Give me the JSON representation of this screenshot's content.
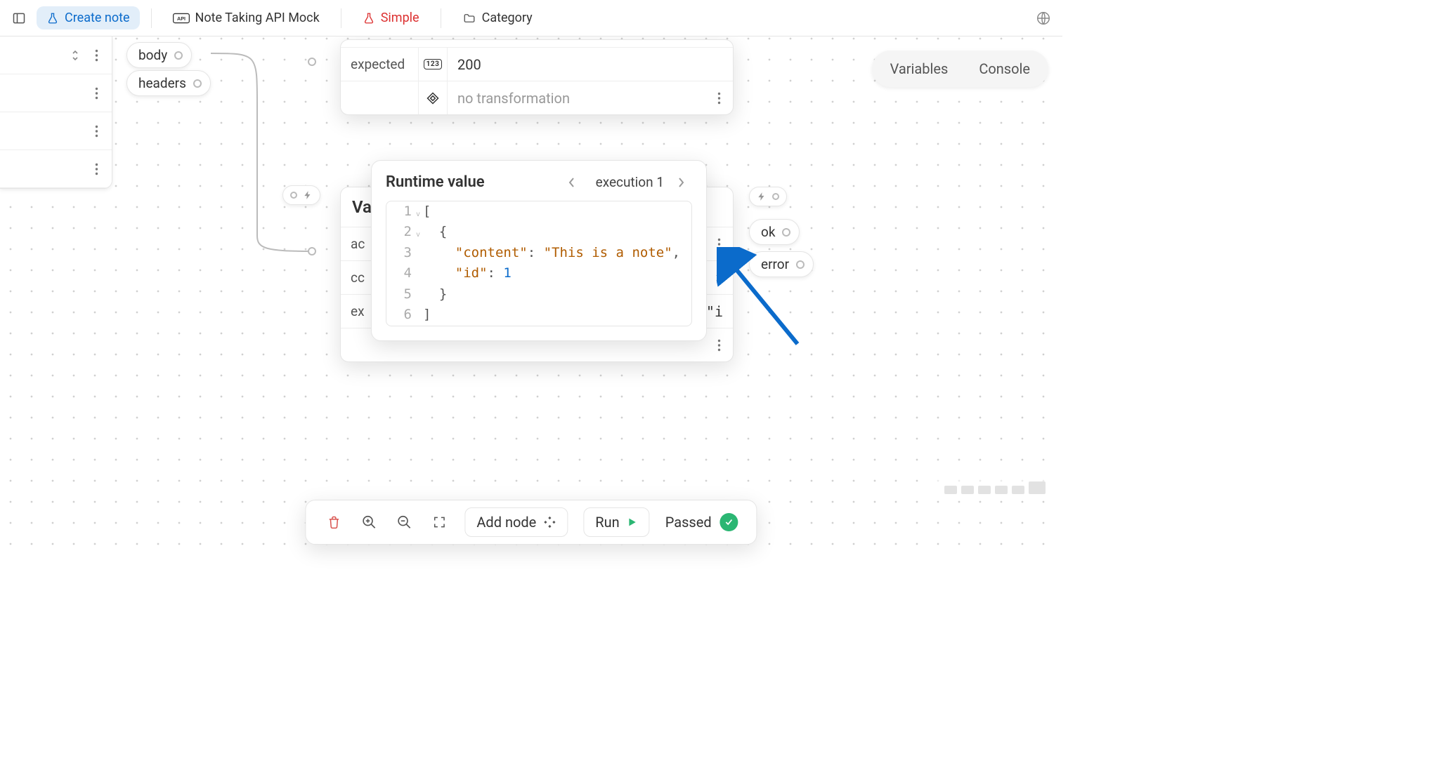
{
  "topbar": {
    "tabs": [
      {
        "label": "Create note",
        "icon": "flask",
        "active": true
      },
      {
        "label": "Note Taking API Mock",
        "icon": "api"
      },
      {
        "label": "Simple",
        "icon": "flask",
        "red": true
      },
      {
        "label": "Category",
        "icon": "folder"
      }
    ]
  },
  "node_outputs": {
    "left": [
      {
        "label": "body"
      },
      {
        "label": "headers"
      }
    ],
    "right": [
      {
        "label": "ok"
      },
      {
        "label": "error"
      }
    ]
  },
  "expected_panel": {
    "label": "expected",
    "value": "200",
    "transform_placeholder": "no transformation"
  },
  "va_panel": {
    "title_fragment": "Va",
    "rows": [
      "ac",
      "cc",
      "ex"
    ],
    "peek": "\"i"
  },
  "runtime_popover": {
    "title": "Runtime value",
    "execution_label": "execution 1",
    "code_lines": [
      {
        "n": 1,
        "fold": true,
        "tokens": [
          {
            "t": "punc",
            "v": "["
          }
        ]
      },
      {
        "n": 2,
        "fold": true,
        "tokens": [
          {
            "t": "pad",
            "v": "  "
          },
          {
            "t": "punc",
            "v": "{"
          }
        ]
      },
      {
        "n": 3,
        "tokens": [
          {
            "t": "pad",
            "v": "    "
          },
          {
            "t": "key",
            "v": "\"content\""
          },
          {
            "t": "punc",
            "v": ": "
          },
          {
            "t": "str",
            "v": "\"This is a note\""
          },
          {
            "t": "punc",
            "v": ","
          }
        ]
      },
      {
        "n": 4,
        "tokens": [
          {
            "t": "pad",
            "v": "    "
          },
          {
            "t": "key",
            "v": "\"id\""
          },
          {
            "t": "punc",
            "v": ": "
          },
          {
            "t": "num",
            "v": "1"
          }
        ]
      },
      {
        "n": 5,
        "tokens": [
          {
            "t": "pad",
            "v": "  "
          },
          {
            "t": "punc",
            "v": "}"
          }
        ]
      },
      {
        "n": 6,
        "tokens": [
          {
            "t": "punc",
            "v": "]"
          }
        ]
      }
    ]
  },
  "vc_pill": {
    "left": "Variables",
    "right": "Console"
  },
  "bottom_toolbar": {
    "add_node": "Add node",
    "run": "Run",
    "status": "Passed"
  }
}
